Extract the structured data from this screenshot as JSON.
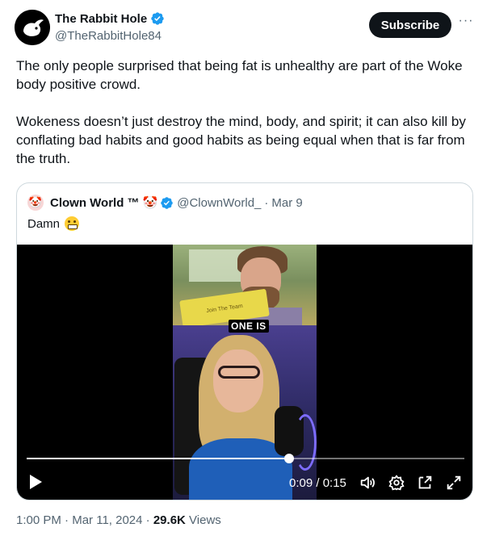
{
  "author": {
    "display_name": "The Rabbit Hole",
    "handle": "@TheRabbitHole84",
    "avatar_icon": "rabbit-logo-icon",
    "verified": true
  },
  "actions": {
    "subscribe_label": "Subscribe",
    "more_label": "···"
  },
  "tweet": {
    "paragraphs": [
      "The only people surprised that being fat is unhealthy are part of the Woke body positive crowd.",
      "Wokeness doesn’t just destroy the mind, body, and spirit; it can also kill by conflating bad habits and good habits as being equal when that is far from the truth."
    ]
  },
  "quote": {
    "avatar_emoji": "🤡",
    "display_name": "Clown World ™",
    "name_emoji": "🤡",
    "verified": true,
    "handle": "@ClownWorld_",
    "separator": "·",
    "date": "Mar 9",
    "text": "Damn",
    "text_emoji": "grimacing-face-icon"
  },
  "video": {
    "sign_text": "Join The Team",
    "caption": "ONE IS",
    "current_time": "0:09",
    "duration": "0:15",
    "time_display": "0:09 / 0:15",
    "progress": 0.6,
    "controls": [
      "play-icon",
      "volume-icon",
      "settings-icon",
      "pop-out-icon",
      "fullscreen-icon"
    ]
  },
  "meta": {
    "time": "1:00 PM",
    "separator": "·",
    "date": "Mar 11, 2024",
    "views_count": "29.6K",
    "views_label": "Views"
  },
  "colors": {
    "text_primary": "#0f1419",
    "text_secondary": "#536471",
    "verified_blue": "#1d9bf0",
    "border": "#cfd9de",
    "button_dark": "#0f1419"
  }
}
